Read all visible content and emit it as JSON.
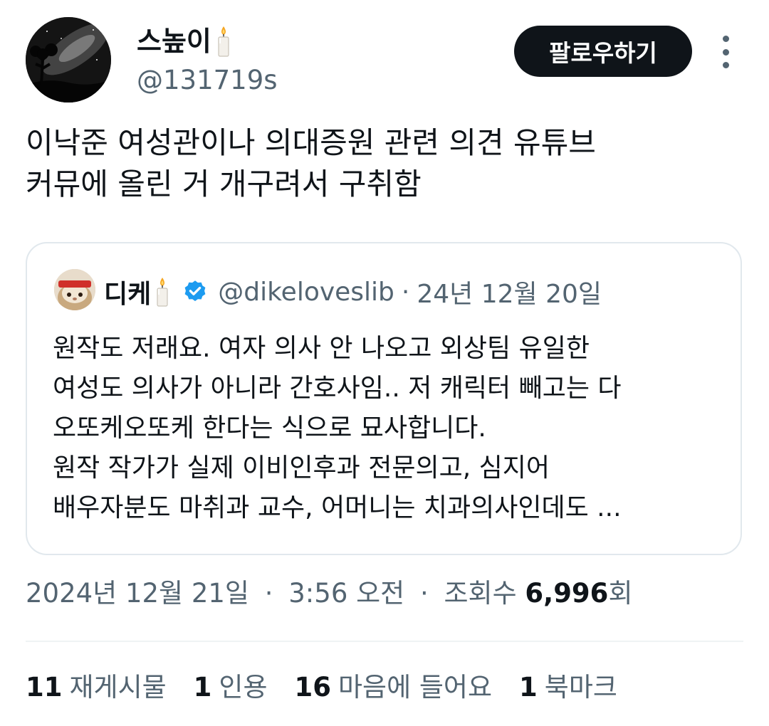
{
  "author": {
    "display_name": "스높이",
    "handle": "@131719s",
    "name_emoji": "candle-icon"
  },
  "follow_button_label": "팔로우하기",
  "more_icon": "more-vertical-icon",
  "tweet": {
    "lines": [
      "이낙준 여성관이나 의대증원 관련 의견 유튜브",
      "커뮤에 올린 거 개구려서 구취함"
    ]
  },
  "quote": {
    "display_name": "디케",
    "name_emoji": "candle-icon",
    "verified_icon": "verified-badge-icon",
    "handle": "@dikeloveslib",
    "separator": "·",
    "date": "24년 12월 20일",
    "lines": [
      "원작도 저래요. 여자 의사 안 나오고 외상팀 유일한",
      "여성도 의사가 아니라 간호사임.. 저 캐릭터 빼고는 다",
      "오또케오또케 한다는 식으로 묘사합니다.",
      "원작 작가가 실제 이비인후과 전문의고, 심지어",
      "배우자분도 마취과 교수, 어머니는 치과의사인데도 ..."
    ]
  },
  "meta": {
    "date": "2024년 12월 21일",
    "separator": "·",
    "time": "3:56 오전",
    "views_label": "조회수",
    "views_count": "6,996",
    "views_suffix": "회"
  },
  "stats": {
    "reposts_count": "11",
    "reposts_label": "재게시물",
    "quotes_count": "1",
    "quotes_label": "인용",
    "likes_count": "16",
    "likes_label": "마음에 들어요",
    "bookmarks_count": "1",
    "bookmarks_label": "북마크"
  },
  "colors": {
    "text_primary": "#0f1419",
    "text_secondary": "#536471",
    "verified_blue": "#1d9bf0",
    "border": "#e1e8ed",
    "button_bg": "#0f1419"
  }
}
